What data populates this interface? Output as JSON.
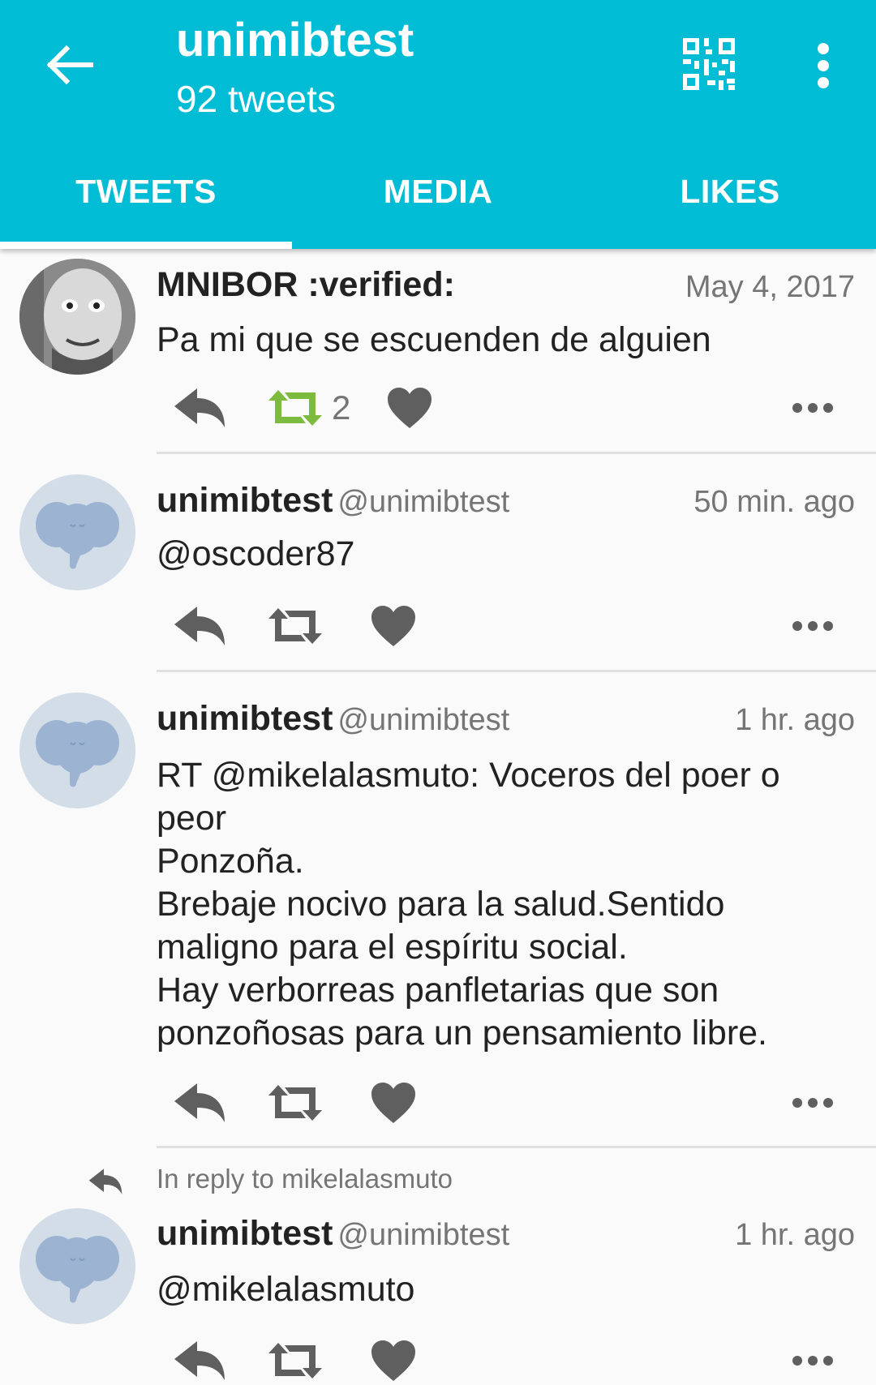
{
  "appbar": {
    "title": "unimibtest",
    "subtitle": "92 tweets",
    "back_icon": "arrow-left-icon",
    "qr_icon": "qr-code-icon",
    "menu_icon": "more-vert-icon"
  },
  "tabs": [
    {
      "label": "TWEETS",
      "active": true
    },
    {
      "label": "MEDIA",
      "active": false
    },
    {
      "label": "LIKES",
      "active": false
    }
  ],
  "tweets": [
    {
      "author": "MNIBOR :verified:",
      "handle": "",
      "time": "May 4, 2017",
      "body": "Pa mi que se escuenden de alguien",
      "retweet_count": "2",
      "retweeted": true,
      "in_reply_to": ""
    },
    {
      "author": "unimibtest",
      "handle": "@unimibtest",
      "time": "50 min. ago",
      "body": "@oscoder87",
      "retweet_count": "",
      "retweeted": false,
      "in_reply_to": ""
    },
    {
      "author": "unimibtest",
      "handle": "@unimibtest",
      "time": "1 hr. ago",
      "body": "RT @mikelalasmuto: Voceros del poer o\npeor\nPonzoña.\nBrebaje nocivo para la salud.Sentido\nmaligno para el espíritu social.\nHay verborreas panfletarias que son\nponzoñosas para un pensamiento libre.",
      "retweet_count": "",
      "retweeted": false,
      "in_reply_to": ""
    },
    {
      "author": "unimibtest",
      "handle": "@unimibtest",
      "time": "1 hr. ago",
      "body": "@mikelalasmuto",
      "retweet_count": "",
      "retweeted": false,
      "in_reply_to": "In reply to mikelalasmuto"
    }
  ],
  "colors": {
    "accent": "#00bcd4",
    "retweet_active": "#7cbb3d",
    "icon_gray": "#5f5f5f"
  }
}
